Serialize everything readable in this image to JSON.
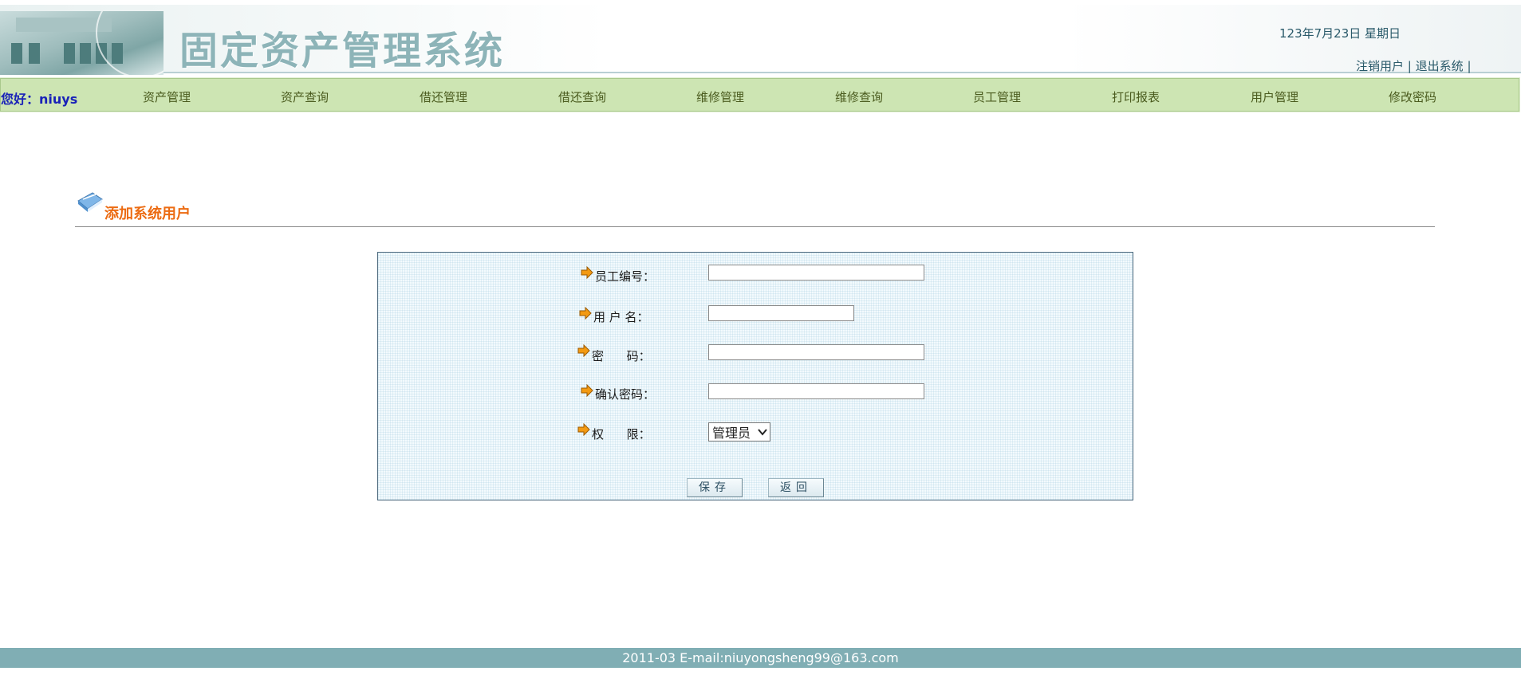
{
  "header": {
    "title": "固定资产管理系统",
    "date": "123年7月23日  星期日",
    "logout_user_label": "注销用户",
    "exit_system_label": "退出系统",
    "separator": "|"
  },
  "nav": {
    "greeting": "您好：niuys",
    "items": [
      "资产管理",
      "资产查询",
      "借还管理",
      "借还查询",
      "维修管理",
      "维修查询",
      "员工管理",
      "打印报表",
      "用户管理",
      "修改密码"
    ]
  },
  "section": {
    "title": "添加系统用户"
  },
  "form": {
    "employee_id_label": "员工编号：",
    "employee_id_value": "",
    "username_label": "用 户 名：",
    "username_value": "",
    "password_label": "密      码：",
    "password_value": "",
    "confirm_password_label": "确认密码：",
    "confirm_password_value": "",
    "permission_label": "权      限：",
    "permission_selected": "管理员",
    "save_label": "保存",
    "back_label": "返回"
  },
  "footer": {
    "text": "2011-03 E-mail:niuyongsheng99@163.com"
  },
  "colors": {
    "nav_bg": "#cde5b3",
    "greeting": "#1a22b8",
    "section_title": "#ec6b12",
    "footer_bg": "#80aeb4",
    "arrow": "#f39a12"
  }
}
